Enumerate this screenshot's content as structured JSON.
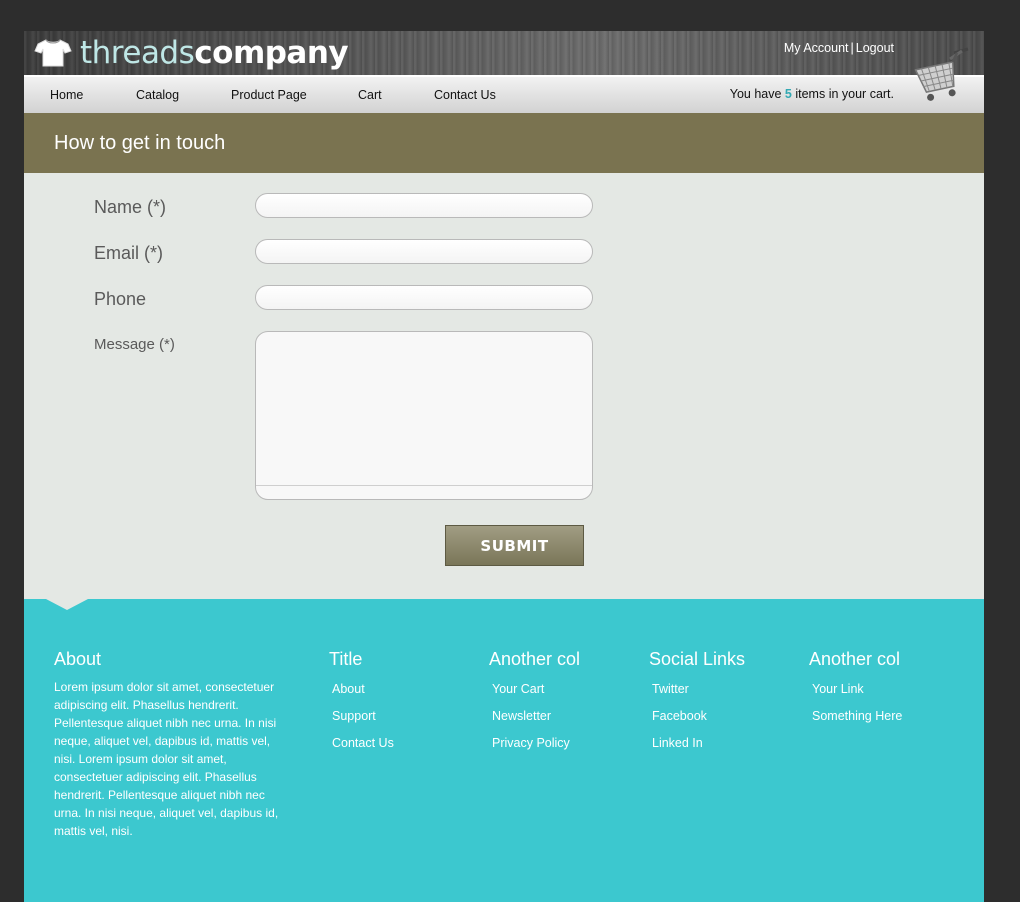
{
  "header": {
    "logo_light": "threads",
    "logo_bold": "company",
    "my_account": "My Account",
    "separator": "|",
    "logout": "Logout"
  },
  "nav": {
    "items": [
      "Home",
      "Catalog",
      "Product Page",
      "Cart",
      "Contact Us"
    ],
    "cart_prefix": "You have",
    "cart_count": "5",
    "cart_suffix": "items in your cart."
  },
  "page_title": "How to get in touch",
  "form": {
    "name_label": "Name (*)",
    "email_label": "Email (*)",
    "phone_label": "Phone",
    "message_label": "Message (*)",
    "name_value": "",
    "email_value": "",
    "phone_value": "",
    "message_value": "",
    "submit_label": "SUBMIT"
  },
  "footer": {
    "about": {
      "title": "About",
      "text": "Lorem ipsum dolor sit amet, consectetuer adipiscing elit. Phasellus hendrerit. Pellentesque aliquet nibh nec urna. In nisi neque, aliquet vel, dapibus id, mattis vel, nisi. Lorem ipsum dolor sit amet, consectetuer adipiscing elit. Phasellus hendrerit. Pellentesque aliquet nibh nec urna. In nisi neque, aliquet vel, dapibus id, mattis vel, nisi."
    },
    "columns": [
      {
        "title": "Title",
        "links": [
          "About",
          "Support",
          "Contact Us"
        ]
      },
      {
        "title": "Another col",
        "links": [
          "Your Cart",
          "Newsletter",
          "Privacy Policy"
        ]
      },
      {
        "title": "Social Links",
        "links": [
          "Twitter",
          "Facebook",
          "Linked In"
        ]
      },
      {
        "title": "Another col",
        "links": [
          "Your Link",
          "Something Here"
        ]
      }
    ]
  },
  "colors": {
    "title_band": "#7a7350",
    "footer": "#3cc8cf",
    "cart_count": "#33a9b3",
    "submit": "#8c8869"
  },
  "icons": {
    "logo": "tshirt-icon",
    "cart": "shopping-cart-icon"
  }
}
